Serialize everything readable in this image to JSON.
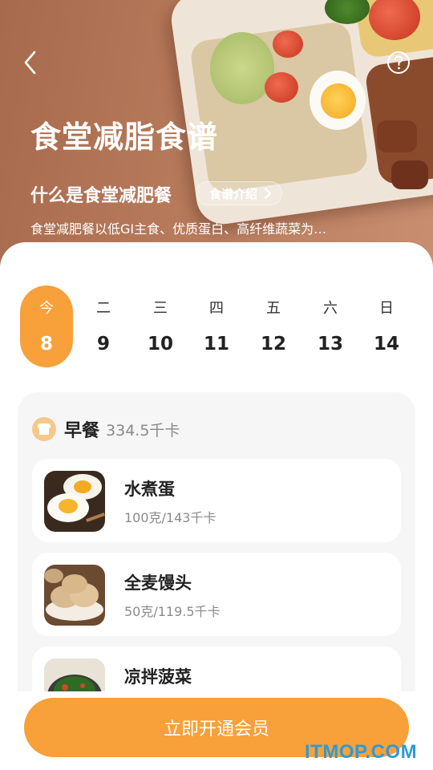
{
  "hero": {
    "title": "食堂减脂食谱",
    "subtitle": "什么是食堂减肥餐",
    "intro_button": "食谱介绍",
    "description": "食堂减肥餐以低GI主食、优质蛋白、高纤维蔬菜为…"
  },
  "week": [
    {
      "weekday": "今",
      "date": "8",
      "selected": true
    },
    {
      "weekday": "二",
      "date": "9"
    },
    {
      "weekday": "三",
      "date": "10"
    },
    {
      "weekday": "四",
      "date": "11"
    },
    {
      "weekday": "五",
      "date": "12"
    },
    {
      "weekday": "六",
      "date": "13"
    },
    {
      "weekday": "日",
      "date": "14"
    }
  ],
  "meal": {
    "title": "早餐",
    "calories": "334.5千卡",
    "items": [
      {
        "name": "水煮蛋",
        "amount": "100克/143千卡"
      },
      {
        "name": "全麦馒头",
        "amount": "50克/119.5千卡"
      },
      {
        "name": "凉拌菠菜",
        "amount": ""
      }
    ]
  },
  "cta": {
    "label": "立即开通会员"
  },
  "watermark": "ITMOP.COM",
  "colors": {
    "accent": "#f8a03a",
    "hero_bg": "#b77a5b",
    "card_bg": "#f6f6f6"
  },
  "icons": {
    "back": "chevron-left-icon",
    "help": "question-circle-icon",
    "intro": "chevron-right-icon",
    "meal": "bread-icon"
  }
}
